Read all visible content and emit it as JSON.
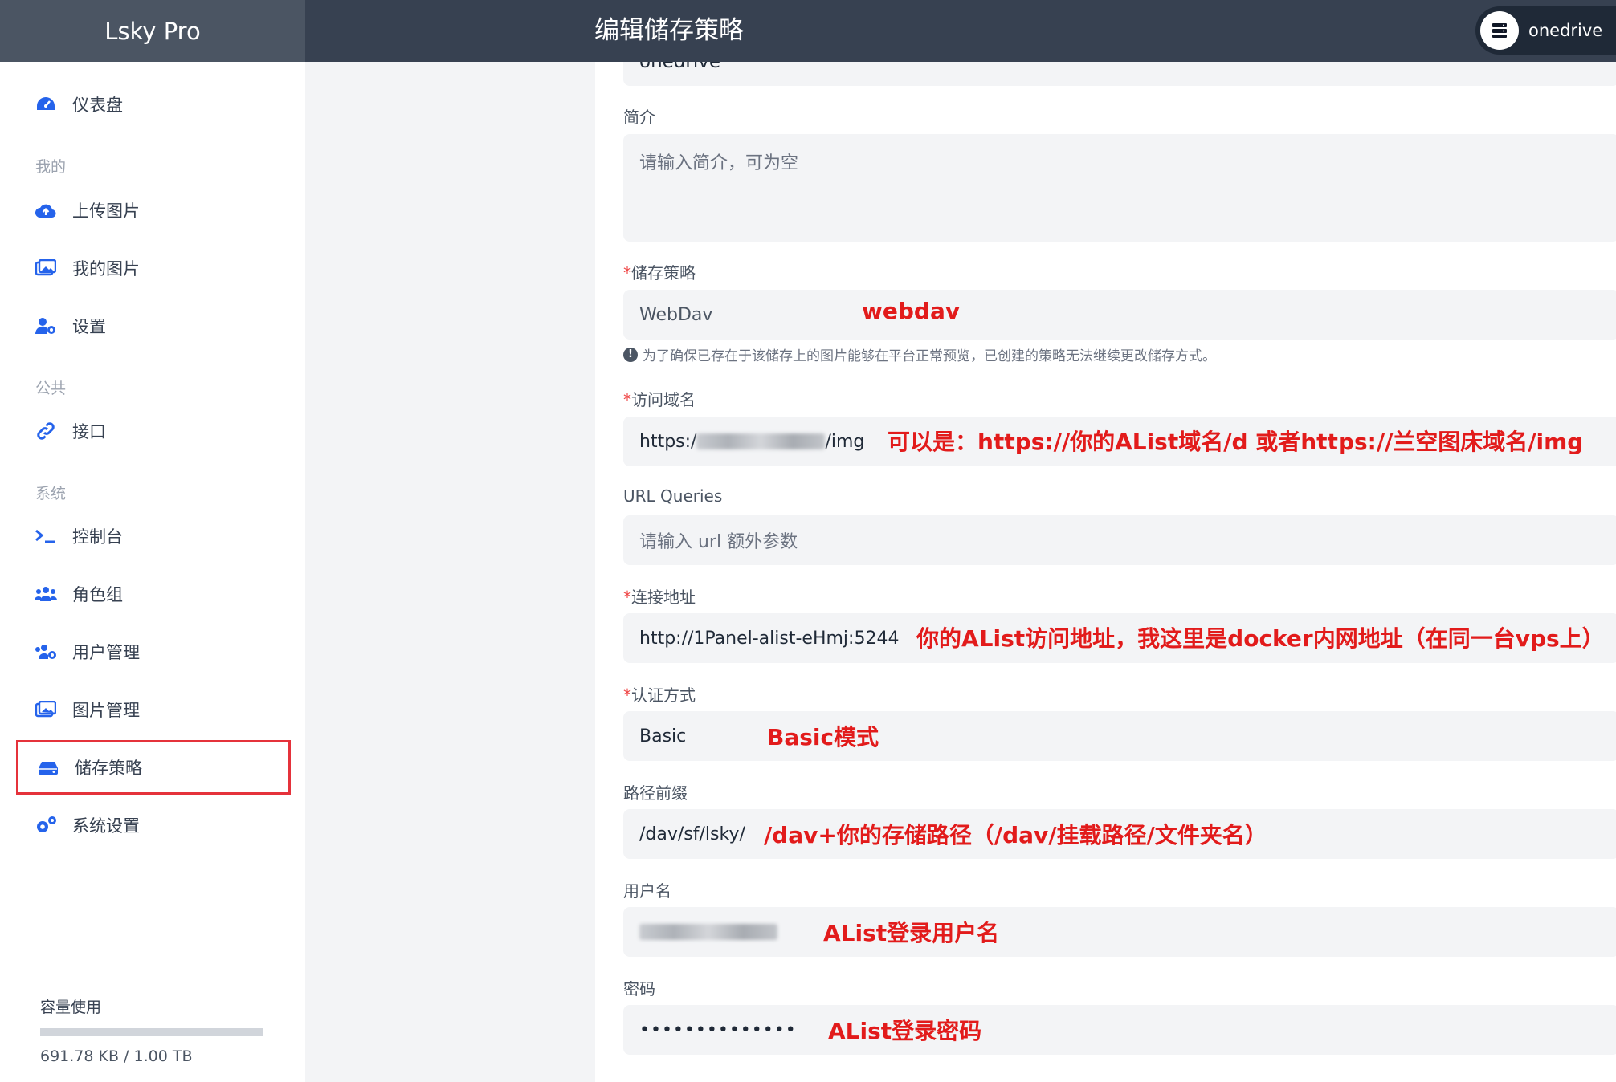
{
  "app": {
    "brand": "Lsky Pro",
    "page_title": "编辑储存策略",
    "user_name": "onedrive"
  },
  "sidebar": {
    "dashboard": "仪表盘",
    "sections": {
      "mine": "我的",
      "public": "公共",
      "system": "系统"
    },
    "items": {
      "upload": "上传图片",
      "my_images": "我的图片",
      "settings": "设置",
      "api": "接口",
      "console": "控制台",
      "roles": "角色组",
      "users": "用户管理",
      "images": "图片管理",
      "strategies": "储存策略",
      "system_settings": "系统设置"
    },
    "capacity": {
      "title": "容量使用",
      "text": "691.78 KB / 1.00 TB",
      "used_fraction": 0.0
    }
  },
  "form": {
    "name_value": "onedrive",
    "intro": {
      "label": "简介",
      "placeholder": "请输入简介，可为空"
    },
    "strategy": {
      "label": "储存策略",
      "value": "WebDav"
    },
    "strategy_note": "为了确保已存在于该储存上的图片能够在平台正常预览，已创建的策略无法继续更改储存方式。",
    "domain": {
      "label": "访问域名",
      "prefix": "https:/",
      "suffix": "/img"
    },
    "url_queries": {
      "label": "URL Queries",
      "placeholder": "请输入 url 额外参数"
    },
    "endpoint": {
      "label": "连接地址",
      "value": "http://1Panel-alist-eHmj:5244"
    },
    "auth": {
      "label": "认证方式",
      "value": "Basic"
    },
    "prefix": {
      "label": "路径前缀",
      "value": "/dav/sf/lsky/"
    },
    "username": {
      "label": "用户名"
    },
    "password": {
      "label": "密码",
      "value": "••••••••••••••"
    },
    "required_mark": "*"
  },
  "annotations": {
    "strategy": "webdav",
    "domain": "可以是：https://你的AList域名/d 或者https://兰空图床域名/img",
    "endpoint": "你的AList访问地址，我这里是docker内网地址（在同一台vps上）",
    "auth": "Basic模式",
    "prefix": "/dav+你的存储路径（/dav/挂载路径/文件夹名）",
    "username": "AList登录用户名",
    "password": "AList登录密码"
  },
  "colors": {
    "topbar": "#374151",
    "brand_bg": "#4b5563",
    "accent": "#2563eb",
    "annotation": "#e21b1b",
    "highlight_border": "#e5323b"
  }
}
